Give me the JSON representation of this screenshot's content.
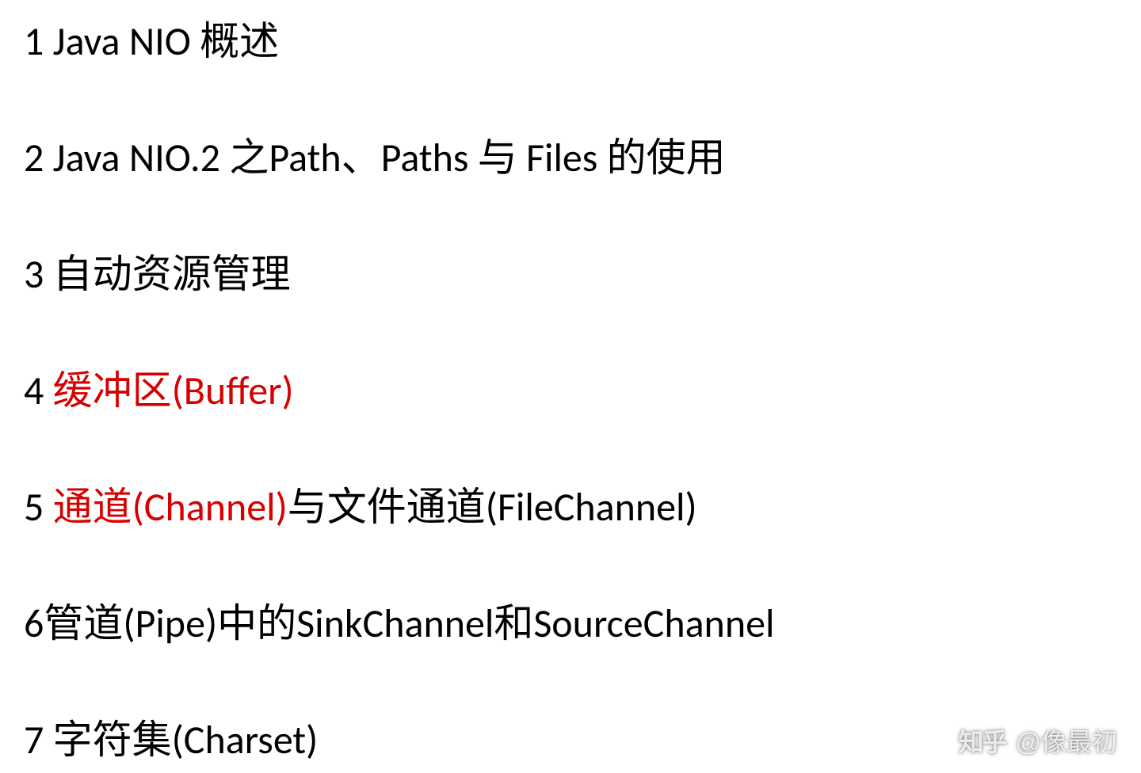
{
  "items": [
    {
      "num": "1",
      "parts": [
        {
          "text": " Java NIO 概述",
          "color": "black"
        }
      ]
    },
    {
      "num": "2",
      "parts": [
        {
          "text": " Java NIO.2 之Path、Paths 与 Files 的使用",
          "color": "black"
        }
      ]
    },
    {
      "num": "3",
      "parts": [
        {
          "text": " 自动资源管理",
          "color": "black"
        }
      ]
    },
    {
      "num": "4",
      "parts": [
        {
          "text": " 缓冲区(Buffer)",
          "color": "red"
        }
      ]
    },
    {
      "num": "5",
      "parts": [
        {
          "text": " 通道(Channel)",
          "color": "red"
        },
        {
          "text": "与文件通道(FileChannel)",
          "color": "black"
        }
      ]
    },
    {
      "num": "6",
      "parts": [
        {
          "text": "管道(Pipe)中的SinkChannel和SourceChannel",
          "color": "black"
        }
      ]
    },
    {
      "num": "7",
      "parts": [
        {
          "text": " 字符集(Charset)",
          "color": "black"
        }
      ]
    }
  ],
  "watermark": {
    "logo": "知乎",
    "author": "@像最初"
  }
}
